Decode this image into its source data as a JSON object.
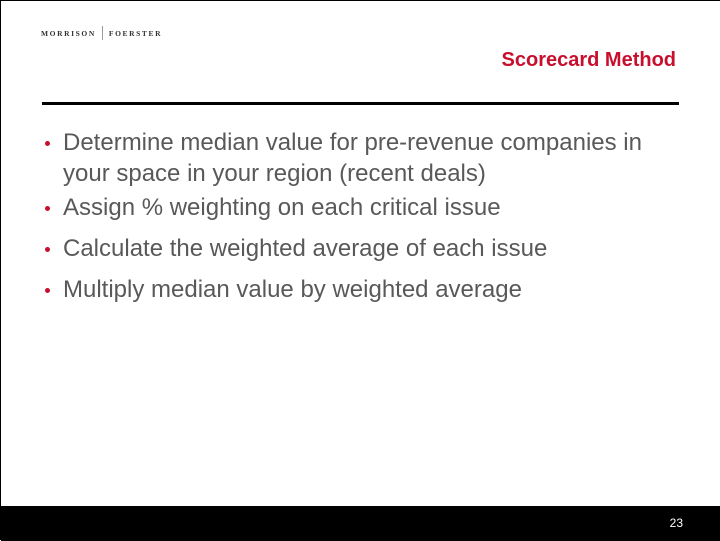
{
  "header": {
    "logo": {
      "left": "MORRISON",
      "right": "FOERSTER"
    },
    "title": "Scorecard Method",
    "accent_color": "#c8102e"
  },
  "bullets": [
    {
      "text": "Determine median value for pre-revenue companies in your space in your region  (recent deals)"
    },
    {
      "text": "Assign % weighting on each critical issue"
    },
    {
      "text": "Calculate the weighted average of each issue"
    },
    {
      "text": "Multiply median value by weighted average"
    }
  ],
  "footer": {
    "page_number": "23"
  }
}
